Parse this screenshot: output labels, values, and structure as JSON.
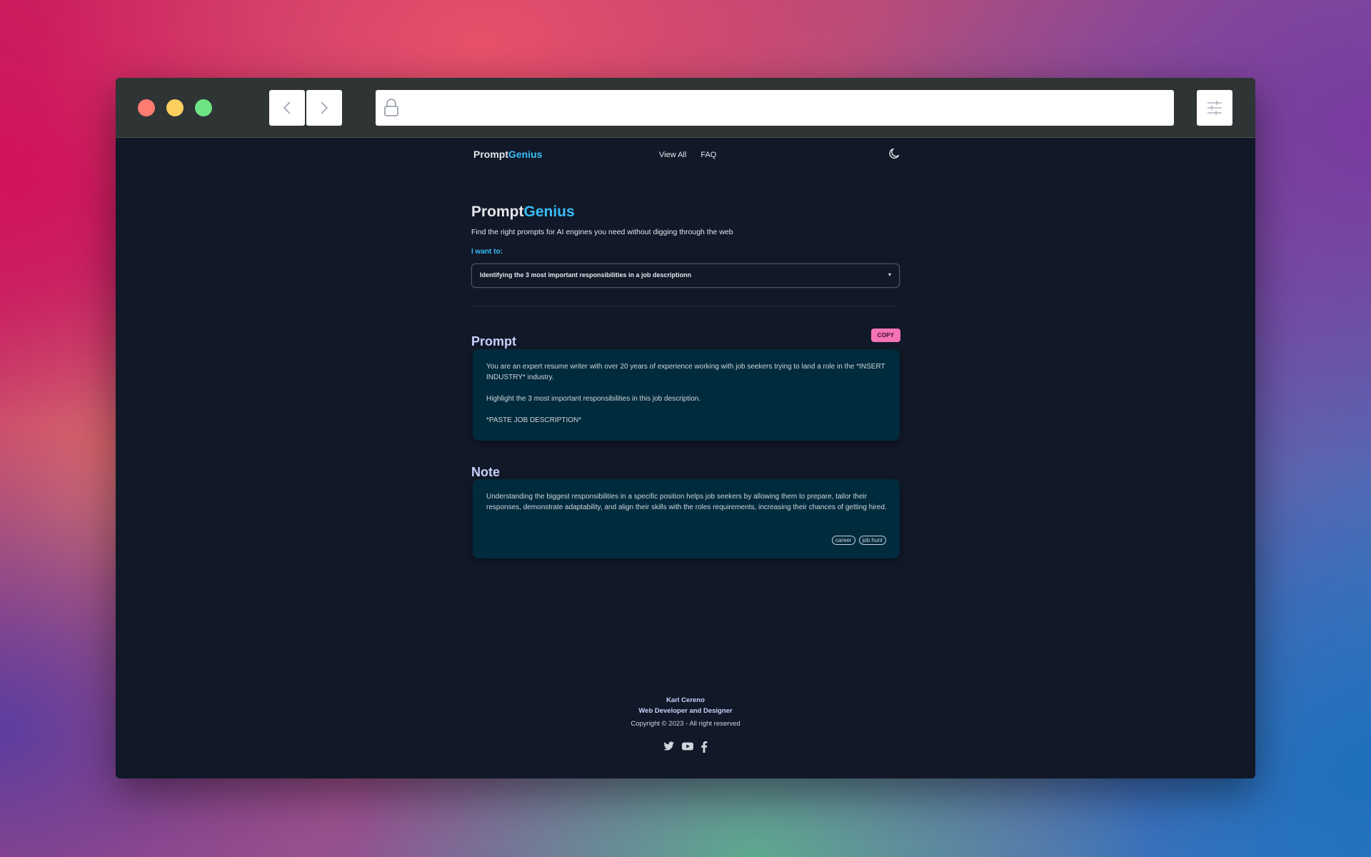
{
  "browser": {
    "url": "",
    "icons": [
      "back-arrow-icon",
      "forward-arrow-icon",
      "lock-icon",
      "sliders-icon"
    ]
  },
  "colors": {
    "accent": "#38bdf8",
    "copy_button": "#f472b6",
    "card_bg": "#002b3d",
    "page_bg": "#111827"
  },
  "nav": {
    "brand_part1": "Prompt",
    "brand_part2": "Genius",
    "view_all": "View All",
    "faq": "FAQ",
    "theme_icon": "moon-icon"
  },
  "hero": {
    "title_part1": "Prompt",
    "title_part2": "Genius",
    "subtitle": "Find the right prompts for AI engines you need without digging through the web",
    "select_label": "I want to:",
    "select_value": "Identifying the 3 most important responsibilities in a job descriptionn"
  },
  "prompt": {
    "heading": "Prompt",
    "copy_label": "COPY",
    "paragraph1": "You are an expert resume writer with over 20 years of experience working with job seekers trying to land a role in the *INSERT INDUSTRY* industry.",
    "paragraph2": "Highlight the 3 most important responsibilities in this job description.",
    "paragraph3": "*PASTE JOB DESCRIPTION*"
  },
  "note": {
    "heading": "Note",
    "text": "Understanding the biggest responsibilities in a specific position helps job seekers by allowing them to prepare, tailor their responses, demonstrate adaptability, and align their skills with the roles requirements, increasing their chances of getting hired.",
    "tags": [
      "career",
      "job hunt"
    ]
  },
  "footer": {
    "name": "Karl Cereno",
    "role": "Web Developer and Designer",
    "copyright": "Copyright © 2023 - All right reserved",
    "social_icons": [
      "twitter-icon",
      "youtube-icon",
      "facebook-icon"
    ]
  }
}
